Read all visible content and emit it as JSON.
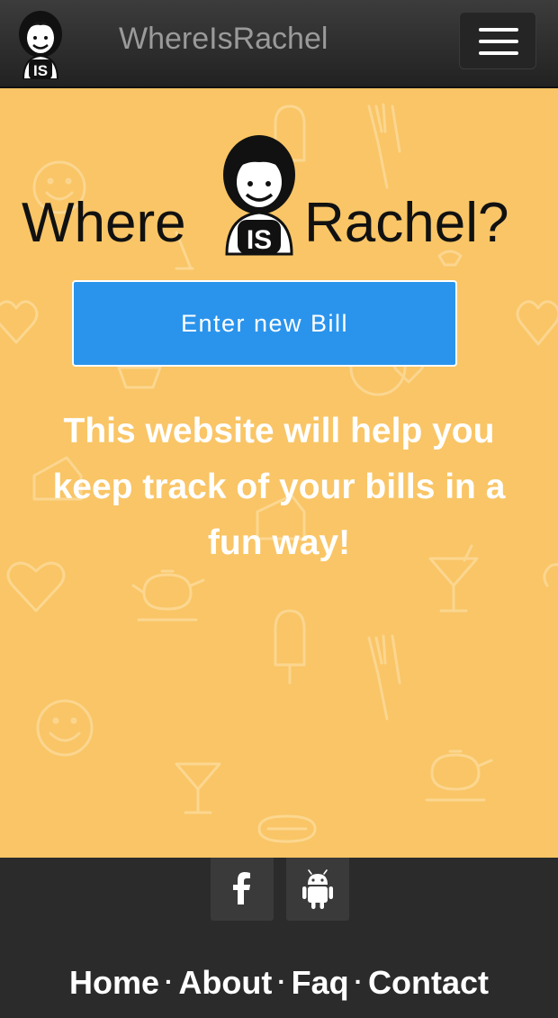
{
  "navbar": {
    "brand": "WhereIsRachel",
    "menu_icon": "hamburger-icon",
    "logo_icon": "rachel-avatar-icon"
  },
  "hero": {
    "logo_text": "Where Is Rachel?",
    "logo_text_left": "Where",
    "logo_badge": "IS",
    "logo_text_right": "Rachel?",
    "cta_label": "Enter new Bill",
    "tagline": "This website will help you keep track of your bills in a fun way!",
    "background_color": "#f9c566",
    "cta_color": "#2a94ec"
  },
  "footer": {
    "social": [
      {
        "name": "facebook",
        "icon": "facebook-icon"
      },
      {
        "name": "android",
        "icon": "android-icon"
      }
    ],
    "links": [
      {
        "label": "Home"
      },
      {
        "label": "About"
      },
      {
        "label": "Faq"
      },
      {
        "label": "Contact"
      }
    ],
    "separator": "·",
    "background_color": "#2b2b2b"
  }
}
